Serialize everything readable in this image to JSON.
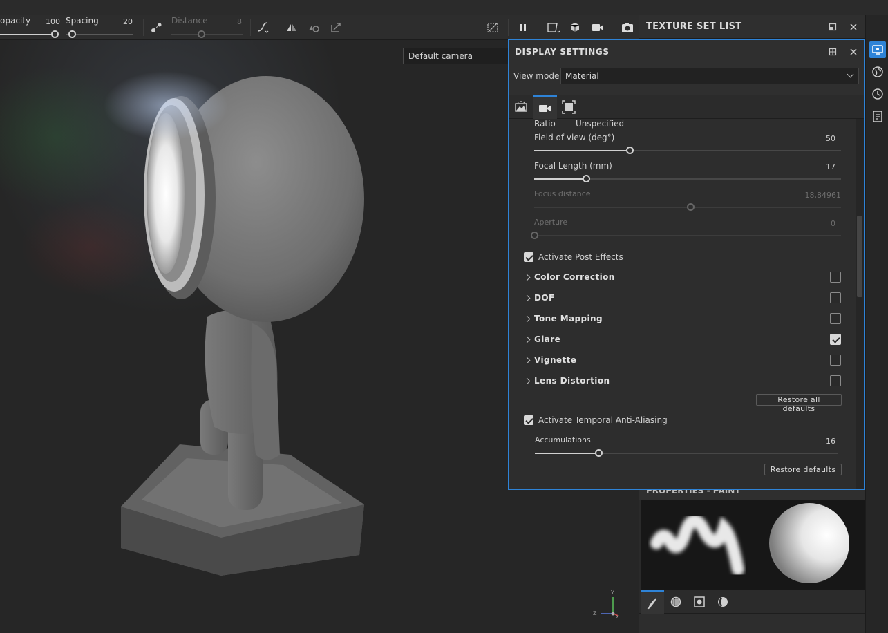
{
  "toolbar": {
    "opacity_label": "opacity",
    "opacity_value": "100",
    "spacing_label": "Spacing",
    "spacing_value": "20",
    "distance_label": "Distance",
    "distance_value": "8"
  },
  "viewport": {
    "camera_select": "Default camera",
    "axis_y": "Y",
    "axis_z": "Z",
    "axis_x": "X"
  },
  "texture_set_list": {
    "title": "TEXTURE SET LIST"
  },
  "display_settings": {
    "title": "DISPLAY SETTINGS",
    "view_mode_label": "View mode",
    "view_mode_value": "Material",
    "ratio_label": "Ratio",
    "ratio_value": "Unspecified",
    "fov_label": "Field of view (deg°)",
    "fov_value": "50",
    "fov_fraction": 0.31,
    "focal_label": "Focal Length (mm)",
    "focal_value": "17",
    "focal_fraction": 0.17,
    "focus_label": "Focus distance",
    "focus_value": "18,84961",
    "focus_fraction": 0.51,
    "aperture_label": "Aperture",
    "aperture_value": "0",
    "aperture_fraction": 0.0,
    "post_effects_label": "Activate Post Effects",
    "post_effects_checked": true,
    "effects": [
      {
        "label": "Color Correction",
        "checked": false
      },
      {
        "label": "DOF",
        "checked": false
      },
      {
        "label": "Tone Mapping",
        "checked": false
      },
      {
        "label": "Glare",
        "checked": true
      },
      {
        "label": "Vignette",
        "checked": false
      },
      {
        "label": "Lens Distortion",
        "checked": false
      }
    ],
    "restore_all_label": "Restore all defaults",
    "taa_label": "Activate Temporal Anti-Aliasing",
    "taa_checked": true,
    "accum_label": "Accumulations",
    "accum_value": "16",
    "accum_fraction": 0.21,
    "restore_label": "Restore defaults"
  },
  "properties": {
    "title": "PROPERTIES - PAINT"
  }
}
